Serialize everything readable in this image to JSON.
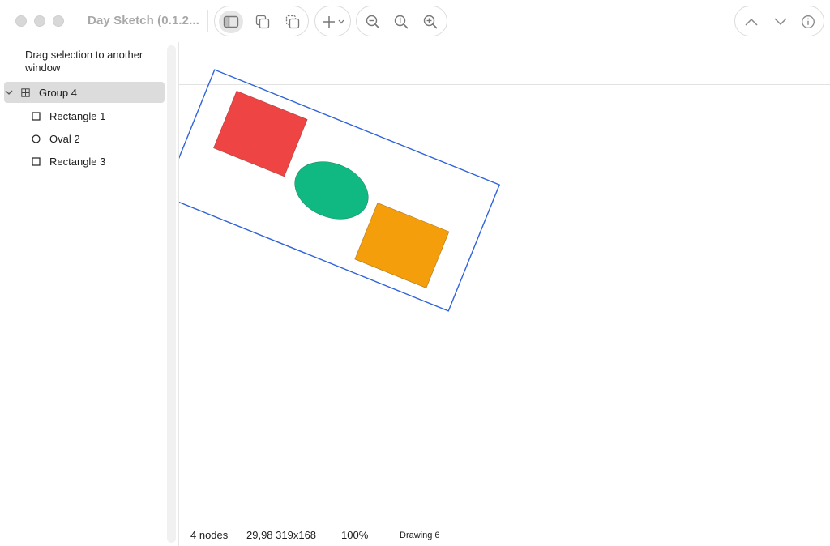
{
  "window": {
    "title": "Day Sketch (0.1.2..."
  },
  "toolbar": {
    "view_buttons": [
      {
        "icon": "sidebar-icon",
        "active": true
      },
      {
        "icon": "duplicate-icon",
        "active": false
      },
      {
        "icon": "copy-icon",
        "active": false
      }
    ],
    "add_button": {
      "icon": "plus-icon",
      "menu_icon": "chevron-down-icon"
    },
    "zoom_buttons": [
      {
        "icon": "zoom-out-icon"
      },
      {
        "icon": "zoom-actual-icon"
      },
      {
        "icon": "zoom-in-icon"
      }
    ],
    "nav_buttons": [
      {
        "icon": "chevron-up-icon"
      },
      {
        "icon": "chevron-down-icon"
      },
      {
        "icon": "info-icon"
      }
    ]
  },
  "sidebar": {
    "hint": "Drag selection to another window",
    "tree": [
      {
        "label": "Group 4",
        "icon": "group-icon",
        "level": 0,
        "expanded": true,
        "selected": true
      },
      {
        "label": "Rectangle 1",
        "icon": "rectangle-icon",
        "level": 1,
        "selected": false
      },
      {
        "label": "Oval 2",
        "icon": "oval-icon",
        "level": 1,
        "selected": false
      },
      {
        "label": "Rectangle 3",
        "icon": "rectangle-icon",
        "level": 1,
        "selected": false
      }
    ]
  },
  "canvas": {
    "shapes": [
      {
        "name": "Rectangle 1",
        "type": "rectangle",
        "fill": "#ef4444"
      },
      {
        "name": "Oval 2",
        "type": "oval",
        "fill": "#10b981"
      },
      {
        "name": "Rectangle 3",
        "type": "rectangle",
        "fill": "#f59e0b"
      }
    ],
    "selection_color": "#2f63d9",
    "rotation_deg": 22
  },
  "status": {
    "node_count": "4 nodes",
    "geometry": "29,98 319x168",
    "zoom": "100%",
    "document": "Drawing 6"
  },
  "colors": {
    "accent": "#2f63d9",
    "selected_row": "#dcdcdc"
  }
}
